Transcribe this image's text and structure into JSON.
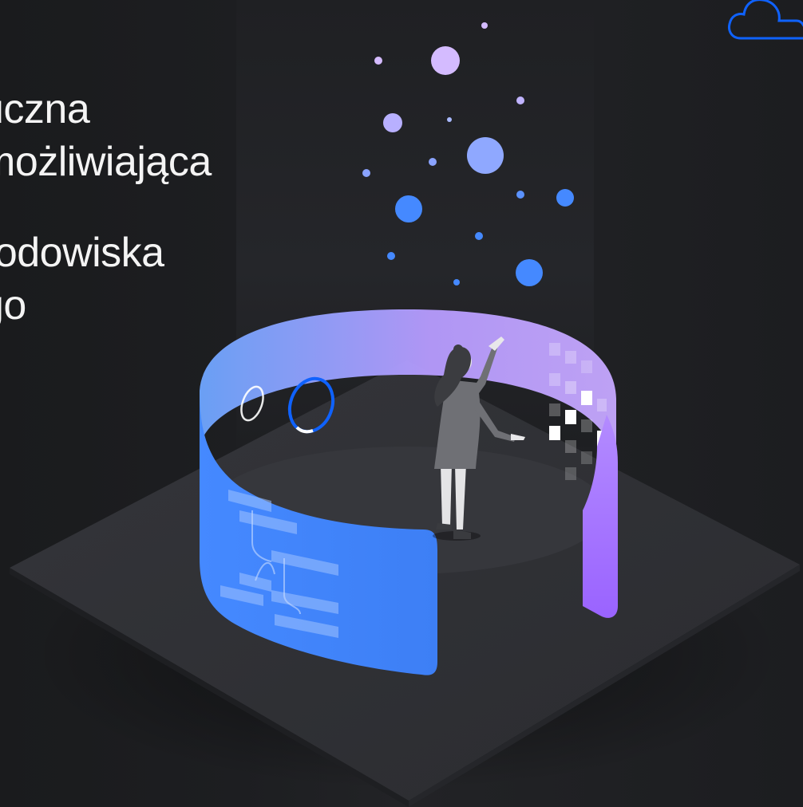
{
  "hero": {
    "lines": [
      "uczna",
      "możliwiająca",
      "rodowiska",
      "go"
    ]
  },
  "colors": {
    "background": "#1b1c1f",
    "platform": "#2f3034",
    "band_left": "#4589ff",
    "band_right": "#a56eff",
    "dots_blue": "#4589ff",
    "dots_purple": "#d4bbff",
    "text": "#f4f4f4"
  },
  "icons": {
    "corner": "cloud-icon"
  }
}
